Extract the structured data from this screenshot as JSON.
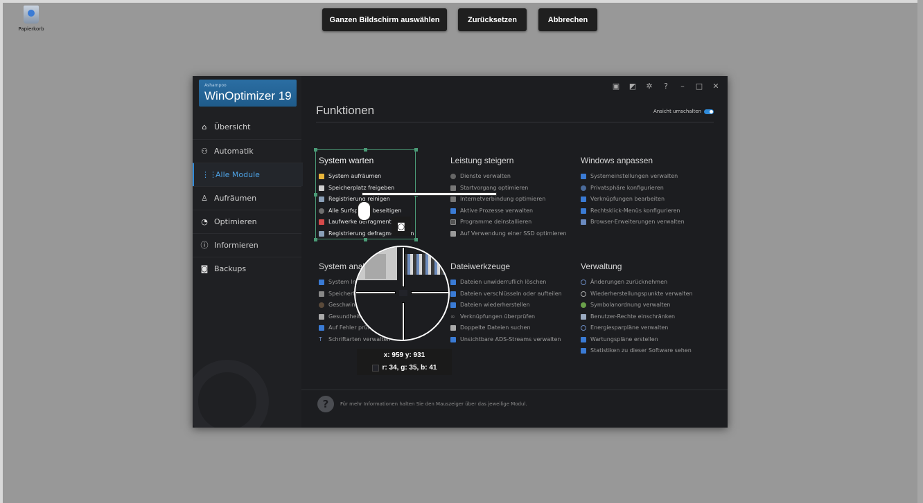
{
  "desktop": {
    "recycle_bin_label": "Papierkorb"
  },
  "capture_toolbar": {
    "select_full_screen": "Ganzen Bildschirm auswählen",
    "reset": "Zurücksetzen",
    "cancel": "Abbrechen"
  },
  "app": {
    "brand_small": "Ashampoo",
    "brand_name": "WinOptimizer 19",
    "title": "Funktionen",
    "view_toggle_label": "Ansicht umschalten",
    "footer_hint": "Für mehr Informationen halten Sie den Mauszeiger über das jeweilige Modul.",
    "nav": [
      {
        "label": "Übersicht",
        "icon": "home-icon"
      },
      {
        "label": "Automatik",
        "icon": "network-icon"
      },
      {
        "label": "Alle Module",
        "icon": "grid-icon"
      },
      {
        "label": "Aufräumen",
        "icon": "broom-icon"
      },
      {
        "label": "Optimieren",
        "icon": "speedometer-icon"
      },
      {
        "label": "Informieren",
        "icon": "info-icon"
      },
      {
        "label": "Backups",
        "icon": "camera-icon"
      }
    ],
    "sections": [
      {
        "title": "System warten",
        "items": [
          "System aufräumen",
          "Speicherplatz freigeben",
          "Registrierung reinigen",
          "Alle Surfspuren beseitigen",
          "Laufwerke defragmentieren",
          "Registrierung defragmentieren"
        ]
      },
      {
        "title": "Leistung steigern",
        "items": [
          "Dienste verwalten",
          "Startvorgang optimieren",
          "Internetverbindung optimieren",
          "Aktive Prozesse verwalten",
          "Programme deinstallieren",
          "Auf Verwendung einer SSD optimieren"
        ]
      },
      {
        "title": "Windows anpassen",
        "items": [
          "Systemeinstellungen verwalten",
          "Privatsphäre konfigurieren",
          "Verknüpfungen bearbeiten",
          "Rechtsklick-Menüs konfigurieren",
          "Browser-Erweiterungen verwalten"
        ]
      },
      {
        "title": "System analysieren",
        "items": [
          "System Informationen",
          "Speicherfresser finden",
          "Geschwindigkeit testen",
          "Gesundheit prüfen",
          "Auf Fehler prüfen",
          "Schriftarten verwalten"
        ]
      },
      {
        "title": "Dateiwerkzeuge",
        "items": [
          "Dateien unwiderruflich löschen",
          "Dateien verschlüsseln oder aufteilen",
          "Dateien wiederherstellen",
          "Verknüpfungen überprüfen",
          "Doppelte Dateien suchen",
          "Unsichtbare ADS-Streams verwalten"
        ]
      },
      {
        "title": "Verwaltung",
        "items": [
          "Änderungen zurücknehmen",
          "Wiederherstellungspunkte verwalten",
          "Symbolanordnung verwalten",
          "Benutzer-Rechte einschränken",
          "Energiesparpläne verwalten",
          "Wartungspläne erstellen",
          "Statistiken zu dieser Software sehen"
        ]
      }
    ]
  },
  "magnifier": {
    "coords": "x: 959 y: 931",
    "rgb": "r: 34, g: 35, b: 41",
    "pixel_color": "#222329"
  }
}
